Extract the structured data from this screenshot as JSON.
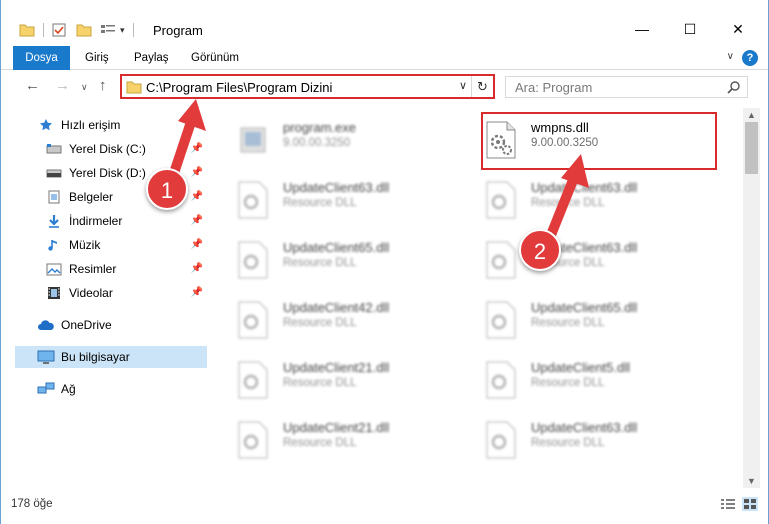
{
  "window": {
    "title": "Program",
    "minimize_glyph": "—",
    "maximize_glyph": "☐",
    "close_glyph": "✕"
  },
  "ribbon": {
    "tabs": [
      {
        "label": "Dosya"
      },
      {
        "label": "Giriş"
      },
      {
        "label": "Paylaş"
      },
      {
        "label": "Görünüm"
      }
    ],
    "help_label": "?"
  },
  "address": {
    "path": "C:\\Program Files\\Program Dizini",
    "search_placeholder": "Ara: Program"
  },
  "sidebar": {
    "items": [
      {
        "label": "Hızlı erişim",
        "icon": "star-icon"
      },
      {
        "label": "Yerel Disk (C:)",
        "icon": "drive-icon"
      },
      {
        "label": "Yerel Disk (D:)",
        "icon": "drive-icon"
      },
      {
        "label": "Belgeler",
        "icon": "documents-icon"
      },
      {
        "label": "İndirmeler",
        "icon": "download-icon"
      },
      {
        "label": "Müzik",
        "icon": "music-icon"
      },
      {
        "label": "Resimler",
        "icon": "pictures-icon"
      },
      {
        "label": "Videolar",
        "icon": "video-icon"
      },
      {
        "label": "OneDrive",
        "icon": "cloud-icon"
      },
      {
        "label": "Bu bilgisayar",
        "icon": "computer-icon"
      },
      {
        "label": "Ağ",
        "icon": "network-icon"
      }
    ]
  },
  "files": [
    {
      "name": "program.exe",
      "sub": "9.00.00.3250"
    },
    {
      "name": "wmpns.dll",
      "sub": "9.00.00.3250"
    },
    {
      "name": "UpdateClient63.dll",
      "sub": "Resource DLL"
    },
    {
      "name": "UpdateClient63.dll",
      "sub": "Resource DLL"
    },
    {
      "name": "UpdateClient65.dll",
      "sub": "Resource DLL"
    },
    {
      "name": "UpdateClient63.dll",
      "sub": "Resource DLL"
    },
    {
      "name": "UpdateClient42.dll",
      "sub": "Resource DLL"
    },
    {
      "name": "UpdateClient65.dll",
      "sub": "Resource DLL"
    },
    {
      "name": "UpdateClient21.dll",
      "sub": "Resource DLL"
    },
    {
      "name": "UpdateClient5.dll",
      "sub": "Resource DLL"
    },
    {
      "name": "UpdateClient21.dll",
      "sub": "Resource DLL"
    },
    {
      "name": "UpdateClient63.dll",
      "sub": "Resource DLL"
    }
  ],
  "status": {
    "count": "178 öğe"
  },
  "annotations": {
    "marker1": "1",
    "marker2": "2",
    "color": "#e23b3b"
  }
}
